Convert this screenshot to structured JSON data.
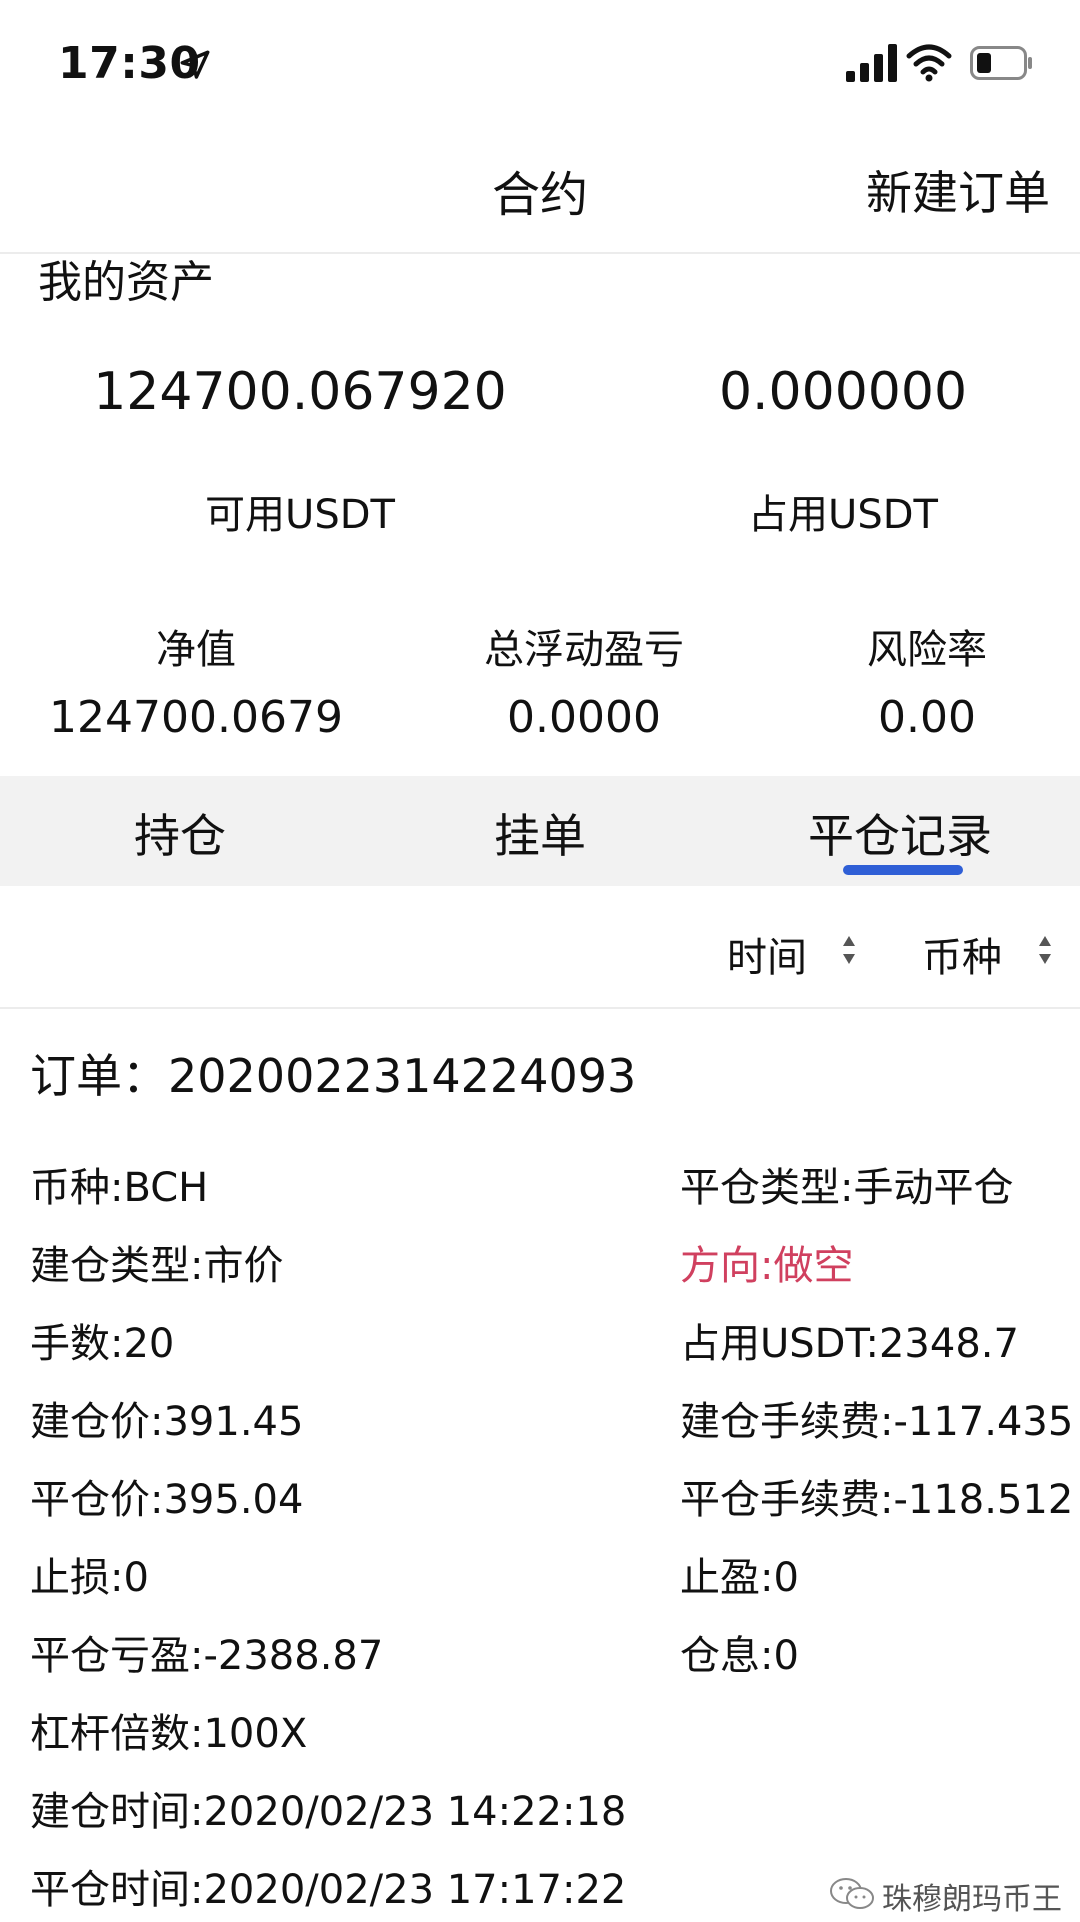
{
  "status_bar": {
    "time": "17:30",
    "icons": [
      "location-arrow-icon",
      "signal-icon",
      "wifi-icon",
      "battery-icon"
    ]
  },
  "nav": {
    "title": "合约",
    "action_label": "新建订单"
  },
  "assets": {
    "section_title": "我的资产",
    "available_value": "124700.067920",
    "available_label": "可用USDT",
    "occupied_value": "0.000000",
    "occupied_label": "占用USDT",
    "net_value_label": "净值",
    "net_value": "124700.0679",
    "floating_pnl_label": "总浮动盈亏",
    "floating_pnl": "0.0000",
    "risk_rate_label": "风险率",
    "risk_rate": "0.00"
  },
  "tabs": [
    {
      "label": "持仓",
      "active": false
    },
    {
      "label": "挂单",
      "active": false
    },
    {
      "label": "平仓记录",
      "active": true
    }
  ],
  "filters": {
    "time_label": "时间",
    "coin_label": "币种"
  },
  "order": {
    "title": "订单：20200223142240​93",
    "left": [
      "币种:BCH",
      "建仓类型:市价",
      "手数:20",
      "建仓价:391.45",
      "平仓价:395.04",
      "止损:0",
      "平仓亏盈:-2388.87",
      "杠杆倍数:100X",
      "建仓时间:2020/02/23 14:22:18",
      "平仓时间:2020/02/23 17:17:22"
    ],
    "right": [
      "平仓类型:手动平仓",
      "方向:做空",
      "占用USDT:2348.7",
      "建仓手续费:-117.435",
      "平仓手续费:-118.512",
      "止盈:0",
      "仓息:0"
    ]
  },
  "watermark": {
    "text": "珠穆朗玛币王"
  },
  "colors": {
    "accent": "#2f5fd6",
    "direction_red": "#d0405f",
    "tab_bg": "#f2f2f2"
  }
}
